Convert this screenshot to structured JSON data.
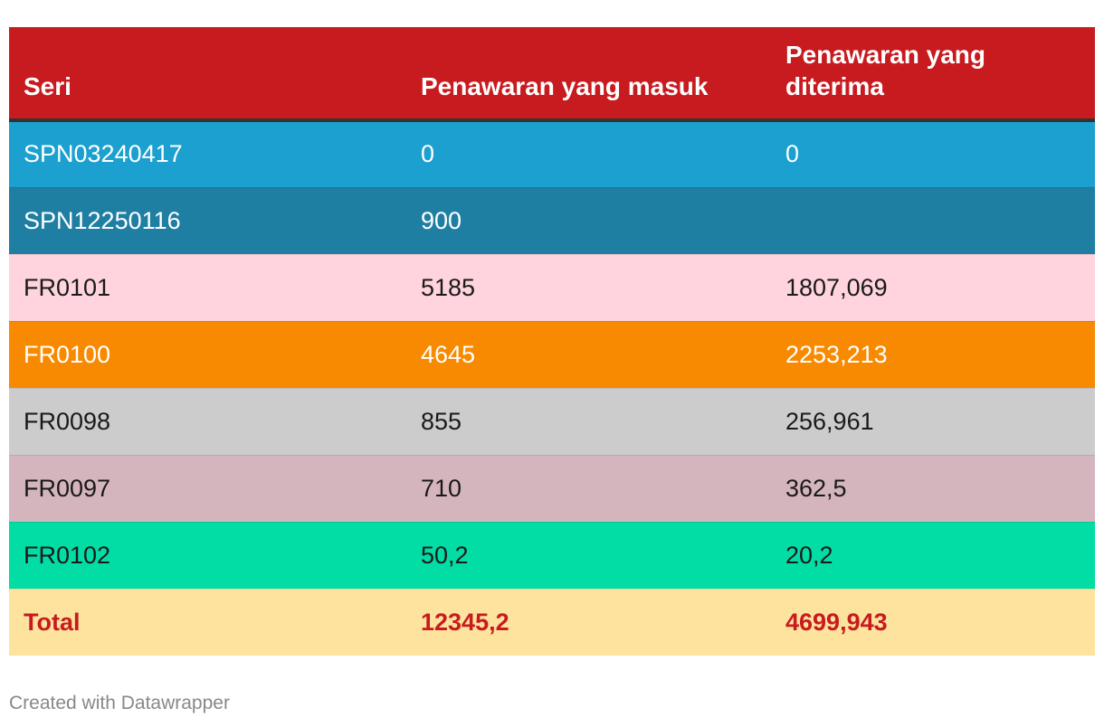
{
  "chart_data": {
    "type": "table",
    "columns": [
      "Seri",
      "Penawaran yang masuk",
      "Penawaran yang diterima"
    ],
    "header_style": {
      "background": "#c81b1f",
      "text_color": "#ffffff"
    },
    "rows": [
      {
        "cells": [
          "SPN03240417",
          "0",
          "0"
        ],
        "background": "#1ba0cf",
        "text_color": "#ffffff",
        "bold": false
      },
      {
        "cells": [
          "SPN12250116",
          "900",
          ""
        ],
        "background": "#1f7fa3",
        "text_color": "#ffffff",
        "bold": false
      },
      {
        "cells": [
          "FR0101",
          "5185",
          "1807,069"
        ],
        "background": "#ffd4de",
        "text_color": "#1a1a1a",
        "bold": false
      },
      {
        "cells": [
          "FR0100",
          "4645",
          "2253,213"
        ],
        "background": "#f78a00",
        "text_color": "#ffffff",
        "bold": false
      },
      {
        "cells": [
          "FR0098",
          "855",
          "256,961"
        ],
        "background": "#cccccc",
        "text_color": "#1a1a1a",
        "bold": false
      },
      {
        "cells": [
          "FR0097",
          "710",
          "362,5"
        ],
        "background": "#d5b5bd",
        "text_color": "#1a1a1a",
        "bold": false
      },
      {
        "cells": [
          "FR0102",
          "50,2",
          "20,2"
        ],
        "background": "#02dca5",
        "text_color": "#1a1a1a",
        "bold": false
      },
      {
        "cells": [
          "Total",
          "12345,2",
          "4699,943"
        ],
        "background": "#fde39e",
        "text_color": "#c81b1f",
        "bold": true
      }
    ]
  },
  "footer": {
    "credit": "Created with Datawrapper"
  }
}
